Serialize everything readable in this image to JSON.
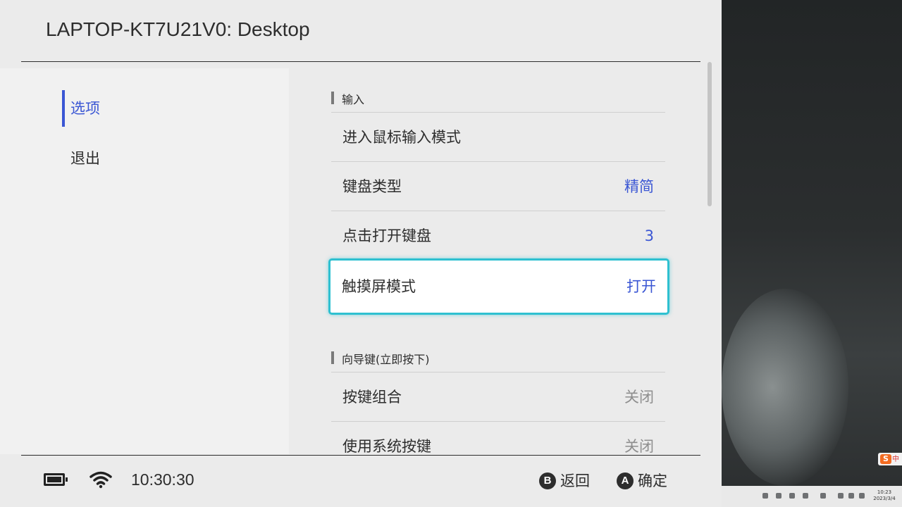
{
  "window": {
    "title": "LAPTOP-KT7U21V0: Desktop"
  },
  "sidebar": {
    "items": [
      {
        "label": "选项"
      },
      {
        "label": "退出"
      }
    ]
  },
  "sections": [
    {
      "header": "输入",
      "rows": [
        {
          "label": "进入鼠标输入模式",
          "value": ""
        },
        {
          "label": "键盘类型",
          "value": "精简"
        },
        {
          "label": "点击打开键盘",
          "value": "3"
        },
        {
          "label": "触摸屏模式",
          "value": "打开"
        }
      ]
    },
    {
      "header": "向导键(立即按下)",
      "rows": [
        {
          "label": "按键组合",
          "value": "关闭"
        },
        {
          "label": "使用系统按键",
          "value": "关闭"
        }
      ]
    }
  ],
  "footer": {
    "time": "10:30:30",
    "battery_level": 1.0,
    "back": {
      "key": "B",
      "label": "返回"
    },
    "confirm": {
      "key": "A",
      "label": "确定"
    }
  },
  "taskbar": {
    "clock_time": "10:23",
    "clock_date": "2023/3/4",
    "ime_letter": "S",
    "ime_mode": "中"
  },
  "colors": {
    "accent": "#3a56d4",
    "selection": "#2ec0d0",
    "panel_bg": "#ebebeb",
    "sidebar_bg": "#f1f1f1"
  }
}
